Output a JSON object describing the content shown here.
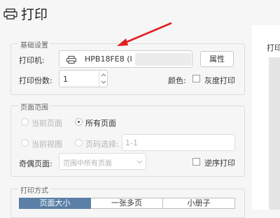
{
  "header": {
    "title": "打印",
    "icon": "printer-icon"
  },
  "right_panel": {
    "label": "打印"
  },
  "basic": {
    "title": "基础设置",
    "printer_label": "打印机:",
    "printer_name": "HPB18FE8 (I",
    "properties_button": "属性",
    "copies_label": "打印份数:",
    "copies_value": "1",
    "color_label": "颜色:",
    "grayscale_label": "灰度打印",
    "grayscale_checked": false
  },
  "range": {
    "title": "页面范围",
    "current_page": "当前页面",
    "all_pages": "所有页面",
    "current_view": "当前视图",
    "page_select": "页码选择:",
    "page_select_value": "1-1",
    "odd_even_label": "奇偶页面:",
    "odd_even_value": "范围中所有页面",
    "reverse_label": "逆序打印",
    "selected": "all_pages"
  },
  "mode": {
    "title": "打印方式",
    "options": [
      "页面大小",
      "一张多页",
      "小册子"
    ],
    "selected_index": 0
  },
  "colors": {
    "accent": "#5b7fa6",
    "annotation_arrow": "#e02020"
  }
}
